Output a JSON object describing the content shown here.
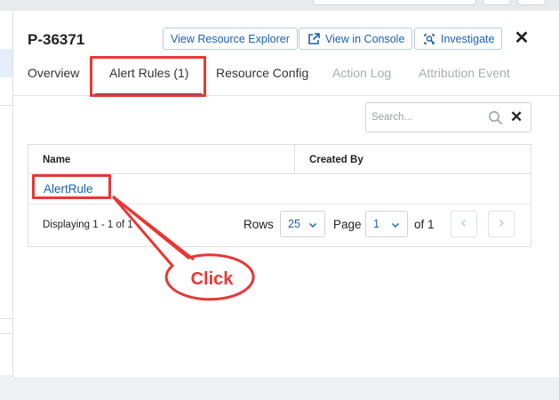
{
  "window": {
    "record_id": "P-36371"
  },
  "header": {
    "view_resource_explorer": "View Resource Explorer",
    "view_in_console": "View in Console",
    "investigate": "Investigate",
    "close": "✕"
  },
  "tabs": [
    {
      "label": "Overview",
      "state": "normal"
    },
    {
      "label": "Alert Rules (1)",
      "state": "active"
    },
    {
      "label": "Resource Config",
      "state": "normal"
    },
    {
      "label": "Action Log",
      "state": "disabled"
    },
    {
      "label": "Attribution Event",
      "state": "disabled"
    }
  ],
  "search": {
    "placeholder": "Search...",
    "value": "",
    "clear": "✕"
  },
  "table": {
    "columns": [
      "Name",
      "Created By"
    ],
    "rows": [
      {
        "name": "AlertRule",
        "created_by": ""
      }
    ]
  },
  "pagination": {
    "displaying": "Displaying 1 - 1 of 1",
    "rows_label": "Rows",
    "rows_value": "25",
    "page_label": "Page",
    "page_value": "1",
    "of_label": "of 1"
  },
  "annotation": {
    "callout_text": "Click"
  },
  "colors": {
    "accent": "#1a5fb4",
    "annotation": "#e53935"
  },
  "icons": [
    "external-link-icon",
    "investigate-icon",
    "close-icon",
    "search-icon",
    "chevron-down-icon",
    "chevron-left-icon",
    "chevron-right-icon"
  ]
}
